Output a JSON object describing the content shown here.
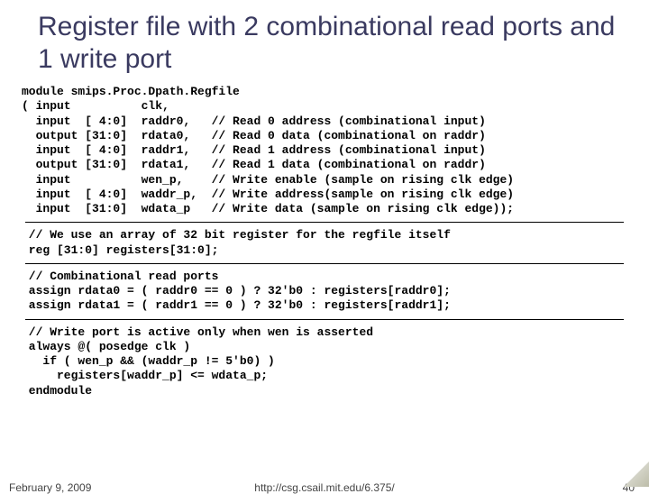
{
  "title": "Register file with 2 combinational read ports and 1 write port",
  "code": {
    "block1": "module smips.Proc.Dpath.Regfile\n( input          clk,\n  input  [ 4:0]  raddr0,   // Read 0 address (combinational input)\n  output [31:0]  rdata0,   // Read 0 data (combinational on raddr)\n  input  [ 4:0]  raddr1,   // Read 1 address (combinational input)\n  output [31:0]  rdata1,   // Read 1 data (combinational on raddr)\n  input          wen_p,    // Write enable (sample on rising clk edge)\n  input  [ 4:0]  waddr_p,  // Write address(sample on rising clk edge)\n  input  [31:0]  wdata_p   // Write data (sample on rising clk edge));",
    "block2": " // We use an array of 32 bit register for the regfile itself\n reg [31:0] registers[31:0];",
    "block3": " // Combinational read ports\n assign rdata0 = ( raddr0 == 0 ) ? 32'b0 : registers[raddr0];\n assign rdata1 = ( raddr1 == 0 ) ? 32'b0 : registers[raddr1];",
    "block4": " // Write port is active only when wen is asserted\n always @( posedge clk )\n   if ( wen_p && (waddr_p != 5'b0) )\n     registers[waddr_p] <= wdata_p;\n endmodule"
  },
  "footer": {
    "date": "February 9, 2009",
    "url": "http://csg.csail.mit.edu/6.375/",
    "page": "40"
  }
}
